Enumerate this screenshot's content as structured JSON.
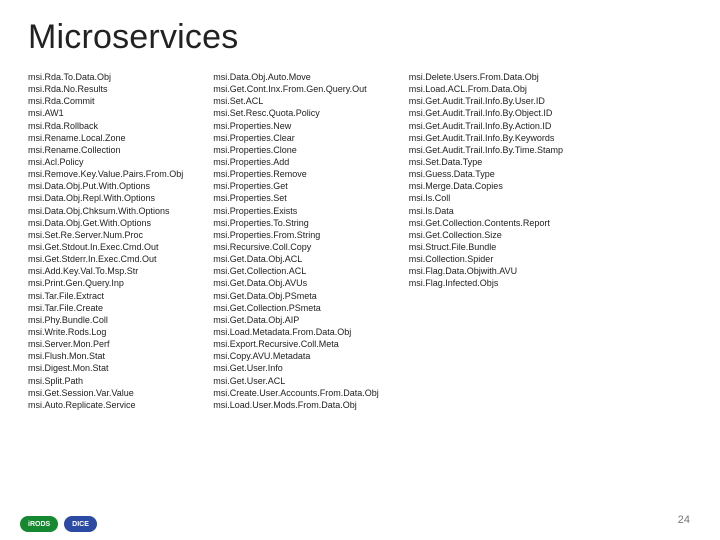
{
  "title": "Microservices",
  "columns": [
    [
      "msi.Rda.To.Data.Obj",
      "msi.Rda.No.Results",
      "msi.Rda.Commit",
      "msi.AW1",
      "msi.Rda.Rollback",
      "msi.Rename.Local.Zone",
      "msi.Rename.Collection",
      "msi.Acl.Policy",
      "msi.Remove.Key.Value.Pairs.From.Obj",
      "msi.Data.Obj.Put.With.Options",
      "msi.Data.Obj.Repl.With.Options",
      "msi.Data.Obj.Chksum.With.Options",
      "msi.Data.Obj.Get.With.Options",
      "msi.Set.Re.Server.Num.Proc",
      "msi.Get.Stdout.In.Exec.Cmd.Out",
      "msi.Get.Stderr.In.Exec.Cmd.Out",
      "msi.Add.Key.Val.To.Msp.Str",
      "msi.Print.Gen.Query.Inp",
      "msi.Tar.File.Extract",
      "msi.Tar.File.Create",
      "msi.Phy.Bundle.Coll",
      "msi.Write.Rods.Log",
      "msi.Server.Mon.Perf",
      "msi.Flush.Mon.Stat",
      "msi.Digest.Mon.Stat",
      "msi.Split.Path",
      "msi.Get.Session.Var.Value",
      "msi.Auto.Replicate.Service"
    ],
    [
      "msi.Data.Obj.Auto.Move",
      "msi.Get.Cont.Inx.From.Gen.Query.Out",
      "msi.Set.ACL",
      "msi.Set.Resc.Quota.Policy",
      "msi.Properties.New",
      "msi.Properties.Clear",
      "msi.Properties.Clone",
      "msi.Properties.Add",
      "msi.Properties.Remove",
      "msi.Properties.Get",
      "msi.Properties.Set",
      "msi.Properties.Exists",
      "msi.Properties.To.String",
      "msi.Properties.From.String",
      "msi.Recursive.Coll.Copy",
      "msi.Get.Data.Obj.ACL",
      "msi.Get.Collection.ACL",
      "msi.Get.Data.Obj.AVUs",
      "msi.Get.Data.Obj.PSmeta",
      "msi.Get.Collection.PSmeta",
      "msi.Get.Data.Obj.AIP",
      "msi.Load.Metadata.From.Data.Obj",
      "msi.Export.Recursive.Coll.Meta",
      "msi.Copy.AVU.Metadata",
      "msi.Get.User.Info",
      "msi.Get.User.ACL",
      "msi.Create.User.Accounts.From.Data.Obj",
      "msi.Load.User.Mods.From.Data.Obj"
    ],
    [
      "msi.Delete.Users.From.Data.Obj",
      "msi.Load.ACL.From.Data.Obj",
      "msi.Get.Audit.Trail.Info.By.User.ID",
      "msi.Get.Audit.Trail.Info.By.Object.ID",
      "msi.Get.Audit.Trail.Info.By.Action.ID",
      "msi.Get.Audit.Trail.Info.By.Keywords",
      "msi.Get.Audit.Trail.Info.By.Time.Stamp",
      "msi.Set.Data.Type",
      "msi.Guess.Data.Type",
      "msi.Merge.Data.Copies",
      "msi.Is.Coll",
      "msi.Is.Data",
      "msi.Get.Collection.Contents.Report",
      "msi.Get.Collection.Size",
      "msi.Struct.File.Bundle",
      "msi.Collection.Spider",
      "msi.Flag.Data.Objwith.AVU",
      "msi.Flag.Infected.Objs"
    ]
  ],
  "page_number": "24",
  "logos": {
    "irods": "iRODS",
    "dice": "DICE"
  }
}
